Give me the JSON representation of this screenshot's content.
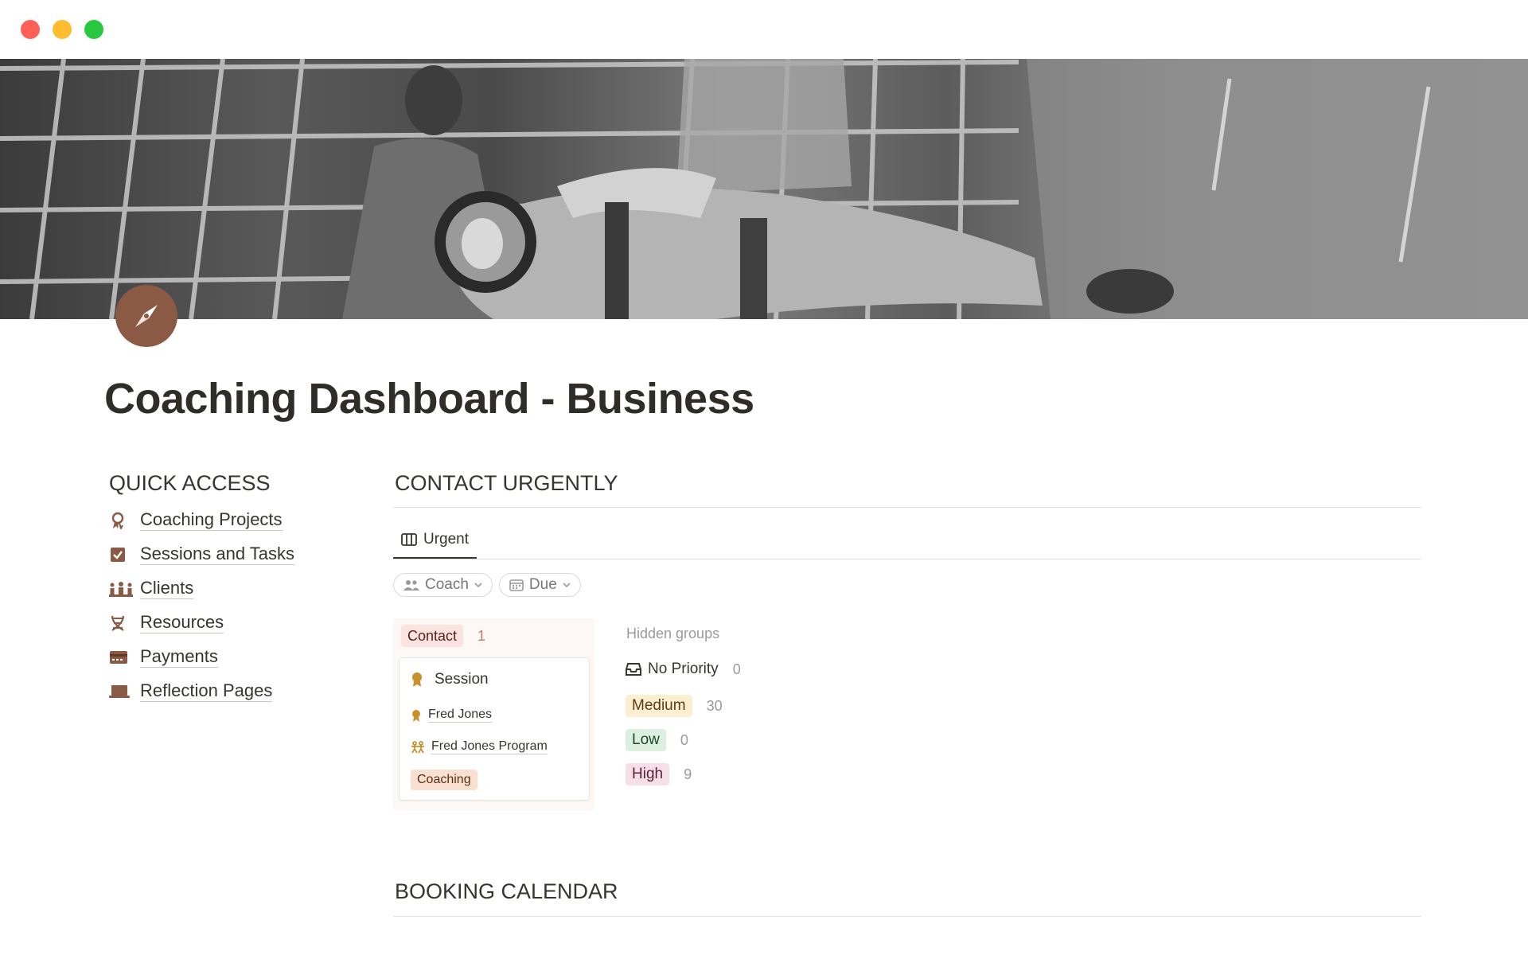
{
  "window": {
    "controls": [
      "close",
      "minimize",
      "maximize"
    ]
  },
  "cover": {
    "description_icon": "astronaut-photo"
  },
  "page": {
    "icon": "compass-icon",
    "icon_color": "#8b5a44",
    "title": "Coaching Dashboard - Business"
  },
  "quick_access": {
    "heading": "QUICK ACCESS",
    "items": [
      {
        "label": "Coaching Projects",
        "icon": "award-icon"
      },
      {
        "label": "Sessions and Tasks",
        "icon": "checkbox-icon"
      },
      {
        "label": "Clients",
        "icon": "group-icon"
      },
      {
        "label": "Resources",
        "icon": "dna-icon"
      },
      {
        "label": "Payments",
        "icon": "card-icon"
      },
      {
        "label": "Reflection Pages",
        "icon": "laptop-icon"
      }
    ]
  },
  "contact_urgently": {
    "heading": "CONTACT URGENTLY",
    "view_tab": "Urgent",
    "filters": [
      {
        "label": "Coach",
        "icon": "people-icon"
      },
      {
        "label": "Due",
        "icon": "calendar-icon"
      }
    ],
    "group": {
      "label": "Contact",
      "count": "1",
      "card": {
        "title": "Session",
        "person": "Fred Jones",
        "program": "Fred Jones Program",
        "tag": "Coaching"
      }
    },
    "hidden_groups": {
      "label": "Hidden groups",
      "items": [
        {
          "label": "No Priority",
          "count": "0",
          "icon": "inbox-icon"
        },
        {
          "label": "Medium",
          "count": "30"
        },
        {
          "label": "Low",
          "count": "0"
        },
        {
          "label": "High",
          "count": "9"
        }
      ]
    }
  },
  "booking_calendar": {
    "heading": "BOOKING CALENDAR"
  },
  "colors": {
    "accent_brown": "#8b5a44",
    "icon_gold": "#c8912e",
    "tag_contact": "#fbe3df",
    "tag_medium": "#fcefd1",
    "tag_low": "#dcefe0",
    "tag_high": "#f7dfe8",
    "tag_coaching": "#fae0d1"
  }
}
